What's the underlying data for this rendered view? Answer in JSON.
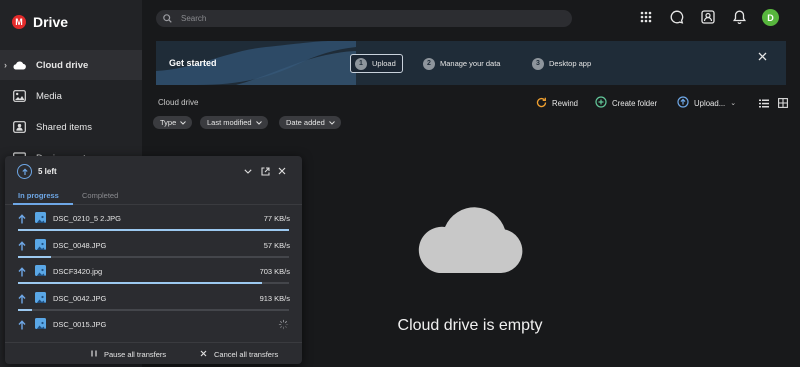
{
  "app": {
    "logo_letter": "M",
    "name": "Drive",
    "brand_color": "#e32b2b"
  },
  "sidebar": {
    "items": [
      {
        "label": "Cloud drive",
        "icon": "cloud-icon",
        "active": true
      },
      {
        "label": "Media",
        "icon": "image-icon",
        "active": false
      },
      {
        "label": "Shared items",
        "icon": "shared-icon",
        "active": false
      },
      {
        "label": "Device centre",
        "icon": "device-icon",
        "active": false
      }
    ]
  },
  "topbar": {
    "search_placeholder": "Search",
    "icons": [
      "apps-grid-icon",
      "chat-icon",
      "contacts-icon",
      "bell-icon"
    ],
    "avatar_initial": "D",
    "avatar_color": "#57b63d"
  },
  "banner": {
    "title": "Get started",
    "steps": [
      {
        "num": "1",
        "label": "Upload",
        "active": true
      },
      {
        "num": "2",
        "label": "Manage your data",
        "active": false
      },
      {
        "num": "3",
        "label": "Desktop app",
        "active": false
      }
    ]
  },
  "toolbar": {
    "breadcrumb": "Cloud drive",
    "rewind": "Rewind",
    "create_folder": "Create folder",
    "upload": "Upload...",
    "filters": [
      "Type",
      "Last modified",
      "Date added"
    ]
  },
  "empty_state": {
    "message": "Cloud drive is empty"
  },
  "transfers": {
    "title": "5 left",
    "tabs": [
      {
        "label": "In progress",
        "active": true
      },
      {
        "label": "Completed",
        "active": false
      }
    ],
    "items": [
      {
        "name": "DSC_0210_5 2.JPG",
        "speed": "77 KB/s",
        "progress": 1.0
      },
      {
        "name": "DSC_0048.JPG",
        "speed": "57 KB/s",
        "progress": 0.12
      },
      {
        "name": "DSCF3420.jpg",
        "speed": "703 KB/s",
        "progress": 0.9
      },
      {
        "name": "DSC_0042.JPG",
        "speed": "913 KB/s",
        "progress": 0.05
      },
      {
        "name": "DSC_0015.JPG",
        "speed": "",
        "progress": 0.0
      }
    ],
    "pause_all": "Pause all transfers",
    "cancel_all": "Cancel all transfers",
    "accent_color": "#6ea7e6"
  }
}
